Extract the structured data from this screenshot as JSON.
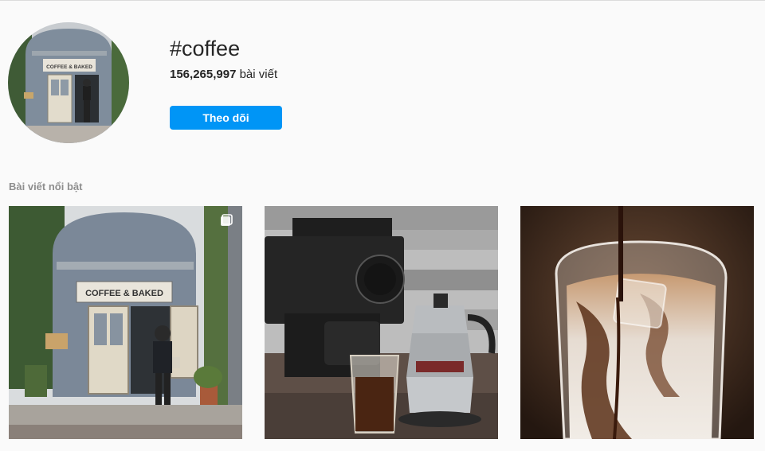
{
  "hashtag": {
    "name": "#coffee",
    "post_count": "156,265,997",
    "post_unit": "bài viết",
    "follow_label": "Theo dõi"
  },
  "top_posts": {
    "title": "Bài viết nổi bật",
    "posts": [
      {
        "icon": "multiple-photos-icon",
        "sign_text": "COFFEE & BAKED"
      },
      {
        "icon": null
      },
      {
        "icon": null
      }
    ]
  },
  "colors": {
    "accent": "#0095f6",
    "background": "#fafafa",
    "text": "#262626",
    "secondary_text": "#8e8e8e"
  }
}
